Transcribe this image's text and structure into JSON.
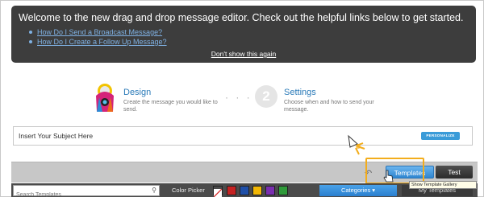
{
  "banner": {
    "title": "Welcome to the new drag and drop message editor. Check out the helpful links below to get started.",
    "links": [
      "How Do I Send a Broadcast Message?",
      "How Do I Create a Follow Up Message?"
    ],
    "dismiss": "Don't show this again"
  },
  "steps": {
    "design": {
      "title": "Design",
      "desc": "Create the message you would like to send."
    },
    "dots": "· · ·",
    "settings": {
      "number": "2",
      "title": "Settings",
      "desc": "Choose when and how to send your message."
    }
  },
  "subject": {
    "value": "Insert Your Subject Here",
    "personalize": "PERSONALIZE"
  },
  "toolbar": {
    "templates": "Templates",
    "test": "Test",
    "tooltip": "Show Template Gallery"
  },
  "bottombar": {
    "search_placeholder": "Search Templates",
    "color_picker": "Color Picker",
    "swatches": [
      "#ffffff",
      "#c62222",
      "#1f4fa8",
      "#f2b705",
      "#7a2fb0",
      "#2f9a3a"
    ],
    "categories": "Categories ▾",
    "my_templates": "My Templates"
  }
}
